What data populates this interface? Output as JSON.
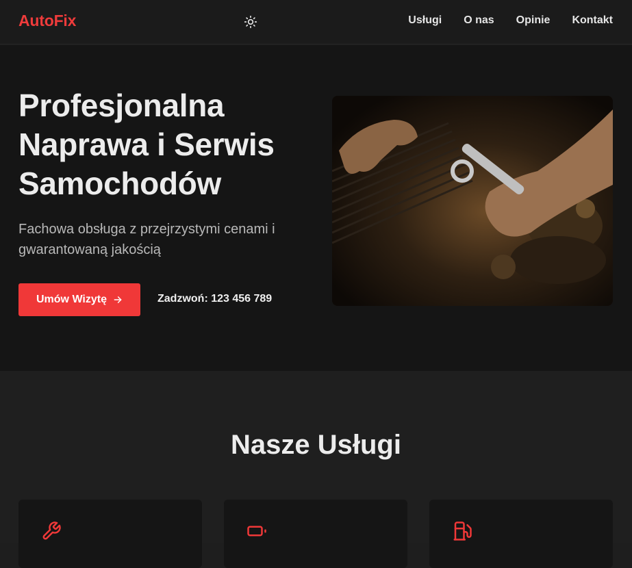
{
  "header": {
    "logo": "AutoFix",
    "theme_icon": "sun-icon",
    "nav": [
      "Usługi",
      "O nas",
      "Opinie",
      "Kontakt"
    ]
  },
  "hero": {
    "title_lines": [
      "Profesjonalna",
      "Naprawa i Serwis",
      "Samochodów"
    ],
    "subtitle": "Fachowa obsługa z przejrzystymi cenami i gwarantowaną jakością",
    "cta_label": "Umów Wizytę",
    "cta_icon": "arrow-right-icon",
    "call_label": "Zadzwoń: 123 456 789",
    "image_icon": "mechanic-engine-photo"
  },
  "services": {
    "title": "Nasze Usługi",
    "cards": [
      {
        "icon": "wrench-icon"
      },
      {
        "icon": "battery-icon"
      },
      {
        "icon": "fuel-pump-icon"
      }
    ]
  },
  "colors": {
    "accent": "#f03838",
    "background": "#151515",
    "surface": "#1f1f1f"
  }
}
